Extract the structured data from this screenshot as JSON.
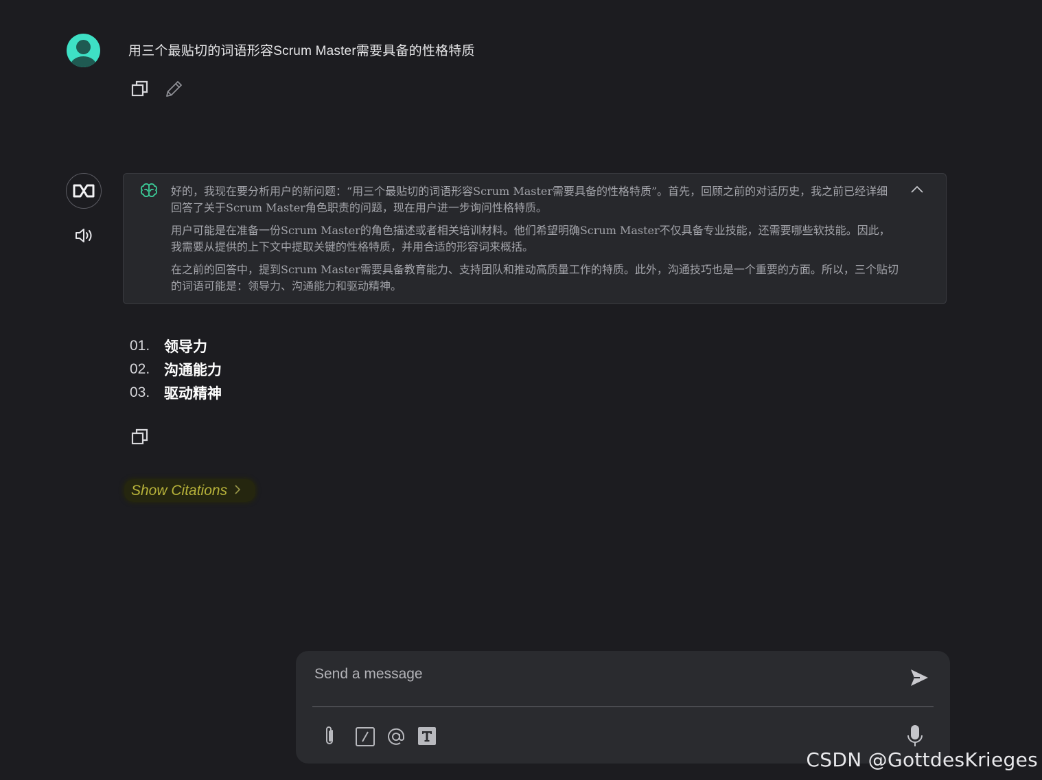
{
  "user_message": {
    "text": "用三个最贴切的词语形容Scrum Master需要具备的性格特质",
    "actions": [
      "copy-icon",
      "edit-icon"
    ]
  },
  "thinking": {
    "paragraphs": [
      "好的，我现在要分析用户的新问题：“用三个最贴切的词语形容Scrum Master需要具备的性格特质”。首先，回顾之前的对话历史，我之前已经详细回答了关于Scrum Master角色职责的问题，现在用户进一步询问性格特质。",
      "用户可能是在准备一份Scrum Master的角色描述或者相关培训材料。他们希望明确Scrum Master不仅具备专业技能，还需要哪些软技能。因此，我需要从提供的上下文中提取关键的性格特质，并用合适的形容词来概括。",
      "在之前的回答中，提到Scrum Master需要具备教育能力、支持团队和推动高质量工作的特质。此外，沟通技巧也是一个重要的方面。所以，三个贴切的词语可能是：领导力、沟通能力和驱动精神。"
    ]
  },
  "answer": {
    "items": [
      {
        "num": "01.",
        "text": "领导力"
      },
      {
        "num": "02.",
        "text": "沟通能力"
      },
      {
        "num": "03.",
        "text": "驱动精神"
      }
    ]
  },
  "citations": {
    "label": "Show Citations"
  },
  "composer": {
    "placeholder": "Send a message"
  },
  "watermark": "CSDN @GottdesKrieges",
  "colors": {
    "background": "#1c1c20",
    "avatar": "#3ee0c5",
    "brain": "#3ccf9a",
    "citations_text": "#b7b23a"
  }
}
